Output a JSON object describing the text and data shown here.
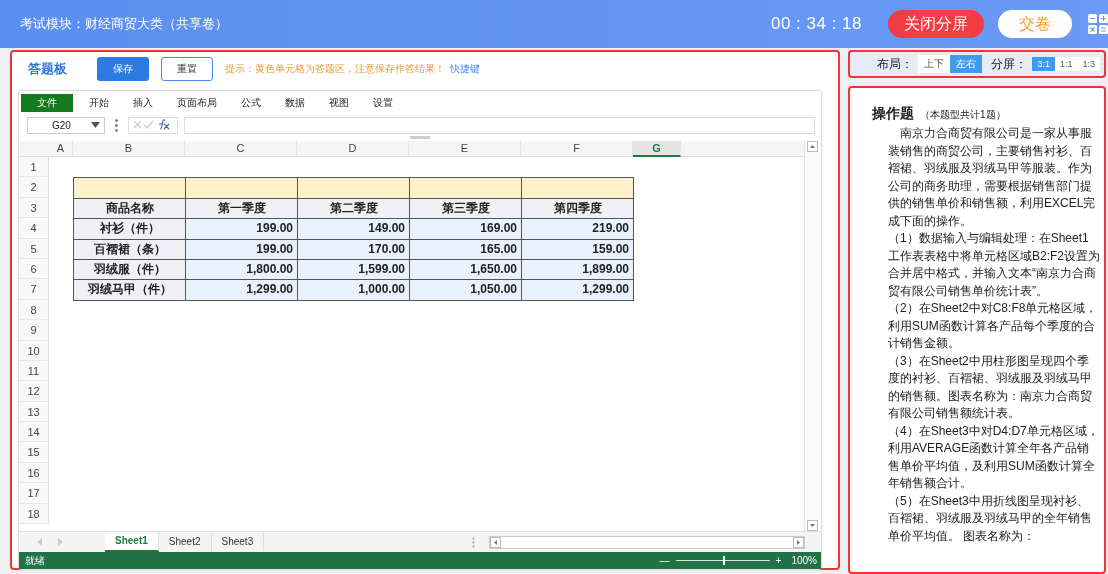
{
  "header": {
    "module_label": "考试模块：财经商贸大类（共享卷）",
    "timer": "00 : 34 : 18",
    "buttons": [
      {
        "label": "关闭分屏",
        "kind": "danger"
      },
      {
        "label": "交卷",
        "kind": "plain"
      }
    ]
  },
  "answer_panel": {
    "title": "答题板",
    "buttons": [
      {
        "label": "保存",
        "kind": "primary"
      },
      {
        "label": "重置",
        "kind": "outline"
      }
    ],
    "hint": "提示：黄色单元格为答题区，注意保存作答结果！",
    "shortcut_link": "快捷键"
  },
  "spreadsheet": {
    "menu": [
      {
        "label": "文件",
        "selected": true
      },
      {
        "label": "开始",
        "selected": false
      },
      {
        "label": "插入",
        "selected": false
      },
      {
        "label": "页面布局",
        "selected": false
      },
      {
        "label": "公式",
        "selected": false
      },
      {
        "label": "数据",
        "selected": false
      },
      {
        "label": "视图",
        "selected": false
      },
      {
        "label": "设置",
        "selected": false
      }
    ],
    "name_box": "G20",
    "columns": [
      {
        "label": "A",
        "selected": false
      },
      {
        "label": "B",
        "selected": false
      },
      {
        "label": "C",
        "selected": false
      },
      {
        "label": "D",
        "selected": false
      },
      {
        "label": "E",
        "selected": false
      },
      {
        "label": "F",
        "selected": false
      },
      {
        "label": "G",
        "selected": true
      }
    ],
    "rows": [
      "1",
      "2",
      "3",
      "4",
      "5",
      "6",
      "7",
      "8",
      "9",
      "10",
      "11",
      "12",
      "13",
      "14",
      "15",
      "16",
      "17",
      "18"
    ],
    "table_rows": [
      {
        "cells": [
          {
            "kind": "answer"
          },
          {
            "kind": "answer"
          },
          {
            "kind": "answer"
          },
          {
            "kind": "answer"
          },
          {
            "kind": "answer"
          }
        ]
      },
      {
        "cells": [
          {
            "kind": "header",
            "text": "商品名称"
          },
          {
            "kind": "header",
            "text": "第一季度"
          },
          {
            "kind": "header",
            "text": "第二季度"
          },
          {
            "kind": "header",
            "text": "第三季度"
          },
          {
            "kind": "header",
            "text": "第四季度"
          }
        ]
      },
      {
        "cells": [
          {
            "kind": "label",
            "text": "衬衫（件）"
          },
          {
            "kind": "value",
            "text": "199.00"
          },
          {
            "kind": "value",
            "text": "149.00"
          },
          {
            "kind": "value",
            "text": "169.00"
          },
          {
            "kind": "value",
            "text": "219.00"
          }
        ]
      },
      {
        "cells": [
          {
            "kind": "label",
            "text": "百褶裙（条）"
          },
          {
            "kind": "value",
            "text": "199.00"
          },
          {
            "kind": "value",
            "text": "170.00"
          },
          {
            "kind": "value",
            "text": "165.00"
          },
          {
            "kind": "value",
            "text": "159.00"
          }
        ]
      },
      {
        "cells": [
          {
            "kind": "label",
            "text": "羽绒服（件）"
          },
          {
            "kind": "value",
            "text": "1,800.00"
          },
          {
            "kind": "value",
            "text": "1,599.00"
          },
          {
            "kind": "value",
            "text": "1,650.00"
          },
          {
            "kind": "value",
            "text": "1,899.00"
          }
        ]
      },
      {
        "cells": [
          {
            "kind": "label",
            "text": "羽绒马甲（件）"
          },
          {
            "kind": "value",
            "text": "1,299.00"
          },
          {
            "kind": "value",
            "text": "1,000.00"
          },
          {
            "kind": "value",
            "text": "1,050.00"
          },
          {
            "kind": "value",
            "text": "1,299.00"
          }
        ]
      }
    ],
    "sheets": [
      {
        "label": "Sheet1",
        "selected": true
      },
      {
        "label": "Sheet2",
        "selected": false
      },
      {
        "label": "Sheet3",
        "selected": false
      }
    ],
    "status": "就绪",
    "zoom": {
      "minus": "—",
      "plus": "+",
      "level": 0.5,
      "reading": "100%"
    }
  },
  "layout_bar": {
    "layout_label": "布局：",
    "layout_options": [
      {
        "label": "上下",
        "selected": false
      },
      {
        "label": "左右",
        "selected": true
      }
    ],
    "split_label": "分屏：",
    "split_options": [
      {
        "label": "3:1",
        "selected": true
      },
      {
        "label": "1:1",
        "selected": false
      },
      {
        "label": "1:3",
        "selected": false
      }
    ]
  },
  "question_panel": {
    "title": "操作题",
    "subtitle": "（本题型共计1题）",
    "paragraphs": [
      {
        "kind": "intro",
        "text": "南京力合商贸有限公司是一家从事服装销售的商贸公司，主要销售衬衫、百褶裙、羽绒服及羽绒马甲等服装。作为公司的商务助理，需要根据销售部门提供的销售单价和销售额，利用EXCEL完成下面的操作。"
      },
      {
        "kind": "step",
        "text": "（1）数据输入与编辑处理：在Sheet1工作表表格中将单元格区域B2:F2设置为合并居中格式，并输入文本“南京力合商贸有限公司销售单价统计表”。"
      },
      {
        "kind": "step",
        "text": "（2）在Sheet2中对C8:F8单元格区域，利用SUM函数计算各产品每个季度的合计销售金额。"
      },
      {
        "kind": "step",
        "text": "（3）在Sheet2中用柱形图呈现四个季度的衬衫、百褶裙、羽绒服及羽绒马甲的销售额。图表名称为：南京力合商贸有限公司销售额统计表。"
      },
      {
        "kind": "step",
        "text": "（4）在Sheet3中对D4:D7单元格区域，利用AVERAGE函数计算全年各产品销售单价平均值，及利用SUM函数计算全年销售额合计。"
      },
      {
        "kind": "step",
        "text": "（5）在Sheet3中用折线图呈现衬衫、百褶裙、羽绒服及羽绒马甲的全年销售单价平均值。 图表名称为："
      }
    ]
  }
}
